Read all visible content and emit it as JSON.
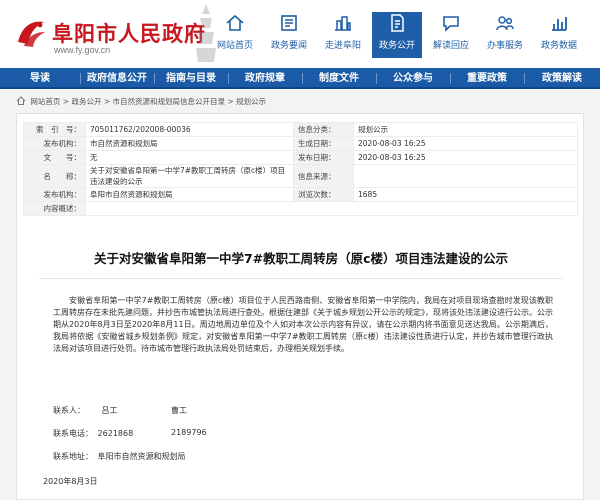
{
  "site": {
    "title": "阜阳市人民政府",
    "url": "www.fy.gov.cn"
  },
  "header_nav": [
    {
      "label": "网站首页",
      "icon": "home-icon"
    },
    {
      "label": "政务要闻",
      "icon": "news-icon"
    },
    {
      "label": "走进阜阳",
      "icon": "city-icon"
    },
    {
      "label": "政务公开",
      "icon": "document-icon",
      "active": true
    },
    {
      "label": "解读回应",
      "icon": "chat-icon"
    },
    {
      "label": "办事服务",
      "icon": "people-icon"
    },
    {
      "label": "政务数据",
      "icon": "data-icon"
    }
  ],
  "main_nav": [
    "导读",
    "政府信息公开",
    "指南与目录",
    "政府规章",
    "制度文件",
    "公众参与",
    "重要政策",
    "政策解读"
  ],
  "breadcrumb": "网站首页 > 政务公开 > 市自然资源和规划局信息公开目录 > 规划公示",
  "info_table": {
    "index_label": "索　引　号：",
    "index_value": "705011762/202008-00036",
    "category_label": "信息分类：",
    "category_value": "规划公示",
    "publisher_label": "发布机构：",
    "publisher_value": "市自然资源和规划局",
    "gen_date_label": "生成日期：",
    "gen_date_value": "2020-08-03 16:25",
    "docno_label": "文　　号：",
    "docno_value": "无",
    "pub_date_label": "发布日期：",
    "pub_date_value": "2020-08-03 16:25",
    "name_label": "名　　称：",
    "name_value": "关于对安徽省阜阳第一中学7#教职工周转房（原c楼）项目违法建设的公示",
    "source_label": "信息来源：",
    "source_value": "",
    "dept_label": "发布机构：",
    "dept_value": "阜阳市自然资源和规划局",
    "views_label": "浏览次数：",
    "views_value": "1685",
    "summary_label": "内容概述："
  },
  "document": {
    "title": "关于对安徽省阜阳第一中学7#教职工周转房（原c楼）项目违法建设的公示",
    "body": "安徽省阜阳第一中学7#教职工周转房（原c楼）项目位于人民西路南侧、安徽省阜阳第一中学院内，我局在对项目现场查勘时发现该教职工周转房存在未批先建问题，并抄告市城管执法局进行查处。根据住建部《关于城乡规划公开公示的规定》，现将该处违法建设进行公示。公示期从2020年8月3日至2020年8月11日。周边地周边单位及个人如对本次公示内容有异议，请在公示期内将书面意见送达我局。公示期满后，我局将依据《安徽省城乡规划条例》规定，对安徽省阜阳第一中学7#教职工周转房（原c楼）违法建设性质进行认定，并抄告城市管理行政执法局对该项目进行处罚。待市城市管理行政执法局处罚结束后，办理相关规划手续。",
    "contact_person_label": "联系人：",
    "contact_person_1": "吕工",
    "contact_person_2": "曹工",
    "contact_phone_label": "联系电话：",
    "contact_phone_1": "2621868",
    "contact_phone_2": "2189796",
    "contact_address_label": "联系地址：",
    "contact_address": "阜阳市自然资源和规划局",
    "date": "2020年8月3日"
  },
  "colors": {
    "brand_red": "#c8161e",
    "nav_blue": "#1b5aa6",
    "icon_blue": "#1f5fa7"
  }
}
